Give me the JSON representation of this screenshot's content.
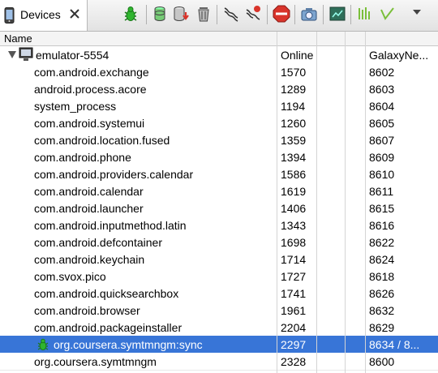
{
  "panel": {
    "tab_title": "Devices",
    "toolbar_buttons": [
      {
        "name": "debug-process-icon"
      },
      {
        "name": "update-heap-icon"
      },
      {
        "name": "dump-hprof-icon"
      },
      {
        "name": "cause-gc-icon"
      },
      {
        "name": "update-threads-icon"
      },
      {
        "name": "start-method-profiling-icon"
      },
      {
        "name": "stop-process-icon"
      },
      {
        "name": "screen-capture-icon"
      },
      {
        "name": "dump-view-hierarchy-icon"
      },
      {
        "name": "systrace-icon"
      },
      {
        "name": "opengl-trace-icon"
      },
      {
        "name": "view-menu-icon"
      }
    ]
  },
  "table": {
    "columns": [
      "Name",
      "",
      ""
    ],
    "device": {
      "name": "emulator-5554",
      "state": "Online",
      "build": "GalaxyNe..."
    },
    "processes": [
      {
        "name": "com.android.exchange",
        "pid": "1570",
        "port": "8602"
      },
      {
        "name": "android.process.acore",
        "pid": "1289",
        "port": "8603"
      },
      {
        "name": "system_process",
        "pid": "1194",
        "port": "8604"
      },
      {
        "name": "com.android.systemui",
        "pid": "1260",
        "port": "8605"
      },
      {
        "name": "com.android.location.fused",
        "pid": "1359",
        "port": "8607"
      },
      {
        "name": "com.android.phone",
        "pid": "1394",
        "port": "8609"
      },
      {
        "name": "com.android.providers.calendar",
        "pid": "1586",
        "port": "8610"
      },
      {
        "name": "com.android.calendar",
        "pid": "1619",
        "port": "8611"
      },
      {
        "name": "com.android.launcher",
        "pid": "1406",
        "port": "8615"
      },
      {
        "name": "com.android.inputmethod.latin",
        "pid": "1343",
        "port": "8616"
      },
      {
        "name": "com.android.defcontainer",
        "pid": "1698",
        "port": "8622"
      },
      {
        "name": "com.android.keychain",
        "pid": "1714",
        "port": "8624"
      },
      {
        "name": "com.svox.pico",
        "pid": "1727",
        "port": "8618"
      },
      {
        "name": "com.android.quicksearchbox",
        "pid": "1741",
        "port": "8626"
      },
      {
        "name": "com.android.browser",
        "pid": "1961",
        "port": "8632"
      },
      {
        "name": "com.android.packageinstaller",
        "pid": "2204",
        "port": "8629"
      },
      {
        "name": "org.coursera.symtmngm:sync",
        "pid": "2297",
        "port": "8634 / 8...",
        "selected": true,
        "debug": true
      },
      {
        "name": "org.coursera.symtmngm",
        "pid": "2328",
        "port": "8600"
      }
    ]
  },
  "colors": {
    "selection": "#3875d7",
    "bug_green": "#2fb52f",
    "stop_red": "#d9342b"
  }
}
